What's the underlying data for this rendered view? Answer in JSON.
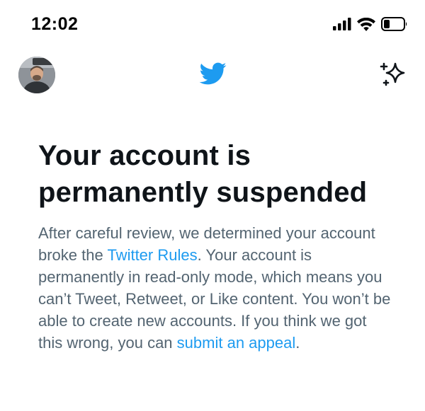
{
  "status_bar": {
    "time": "12:02"
  },
  "header": {
    "logo_icon": "twitter-bird-icon",
    "action_icon": "sparkle-icon"
  },
  "colors": {
    "brand": "#1d9bf0",
    "heading": "#0f1419",
    "body": "#536471",
    "background": "#ffffff"
  },
  "main": {
    "headline": "Your account is permanently suspended",
    "body": {
      "part1": "After careful review, we determined your account broke the ",
      "rules_link": "Twitter Rules",
      "part2": ". Your account is permanently in read-only mode, which means you can’t Tweet, Retweet, or Like content. You won’t be able to create new accounts. If you think we got this wrong, you can ",
      "appeal_link": "submit an appeal",
      "part3": "."
    }
  }
}
